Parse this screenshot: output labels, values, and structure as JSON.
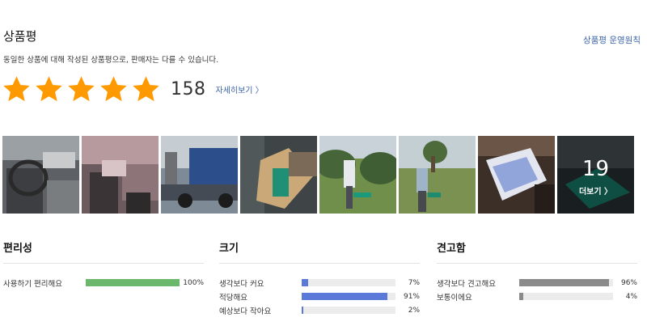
{
  "header": {
    "title": "상품평",
    "policy_link": "상품평 운영원칙",
    "description": "동일한 상품에 대해 작성된 상품평으로, 판매자는 다를 수 있습니다."
  },
  "rating": {
    "stars": 5,
    "count": "158",
    "detail_link": "자세히보기 〉",
    "star_color": "#ff9900"
  },
  "photos": {
    "more_count": "19",
    "more_label": "더보기 〉"
  },
  "attributes": [
    {
      "title": "편리성",
      "bar_color": "#6bb76b",
      "rows": [
        {
          "label": "사용하기 편리해요",
          "value": 100,
          "pct": "100%"
        }
      ]
    },
    {
      "title": "크기",
      "bar_color": "#5a79d8",
      "rows": [
        {
          "label": "생각보다 커요",
          "value": 7,
          "pct": "7%"
        },
        {
          "label": "적당해요",
          "value": 91,
          "pct": "91%"
        },
        {
          "label": "예상보다 작아요",
          "value": 2,
          "pct": "2%"
        }
      ]
    },
    {
      "title": "견고함",
      "bar_color": "#8a8a8a",
      "rows": [
        {
          "label": "생각보다 견고해요",
          "value": 96,
          "pct": "96%"
        },
        {
          "label": "보통이에요",
          "value": 4,
          "pct": "4%"
        }
      ]
    }
  ]
}
